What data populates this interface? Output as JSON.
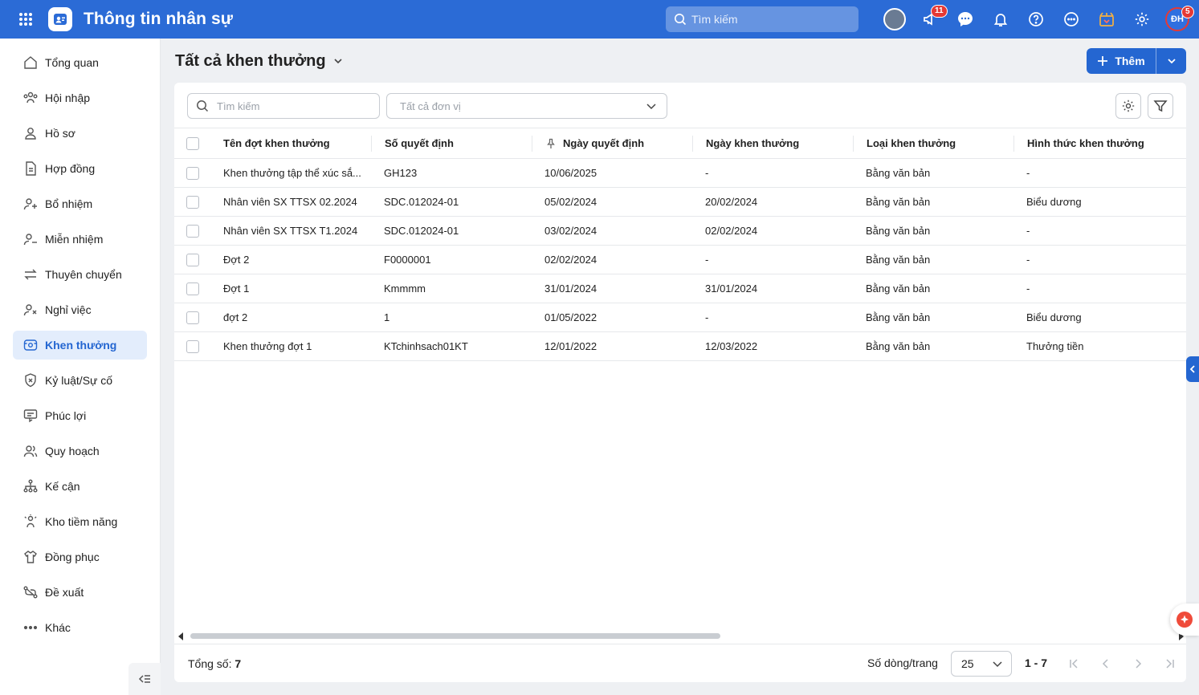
{
  "app": {
    "title": "Thông tin nhân sự",
    "search_placeholder": "Tìm kiếm",
    "user_initials": "ĐH"
  },
  "badges": {
    "announcements": "11",
    "avatar": "5"
  },
  "sidebar": {
    "items": [
      {
        "label": "Tổng quan",
        "icon": "home-icon"
      },
      {
        "label": "Hội nhập",
        "icon": "people-join-icon"
      },
      {
        "label": "Hồ sơ",
        "icon": "user-icon"
      },
      {
        "label": "Hợp đồng",
        "icon": "document-icon"
      },
      {
        "label": "Bổ nhiệm",
        "icon": "user-plus-icon"
      },
      {
        "label": "Miễn nhiệm",
        "icon": "user-minus-icon"
      },
      {
        "label": "Thuyên chuyển",
        "icon": "transfer-icon"
      },
      {
        "label": "Nghỉ việc",
        "icon": "user-x-icon"
      },
      {
        "label": "Khen thưởng",
        "icon": "reward-icon",
        "active": true
      },
      {
        "label": "Kỷ luật/Sự cố",
        "icon": "shield-x-icon"
      },
      {
        "label": "Phúc lợi",
        "icon": "benefit-icon"
      },
      {
        "label": "Quy hoạch",
        "icon": "users-icon"
      },
      {
        "label": "Kế cận",
        "icon": "hierarchy-icon"
      },
      {
        "label": "Kho tiềm năng",
        "icon": "talent-icon"
      },
      {
        "label": "Đồng phục",
        "icon": "shirt-icon"
      },
      {
        "label": "Đề xuất",
        "icon": "route-icon"
      },
      {
        "label": "Khác",
        "icon": "more-icon"
      }
    ]
  },
  "page": {
    "title": "Tất cả khen thưởng",
    "add_label": "Thêm"
  },
  "filters": {
    "search_placeholder": "Tìm kiếm",
    "unit_placeholder": "Tất cả đơn vị"
  },
  "table": {
    "columns": [
      "Tên đợt khen thưởng",
      "Số quyết định",
      "Ngày quyết định",
      "Ngày khen thưởng",
      "Loại khen thưởng",
      "Hình thức khen thưởng"
    ],
    "rows": [
      [
        "Khen thưởng tập thể xúc sắ...",
        "GH123",
        "10/06/2025",
        "-",
        "Bằng văn bản",
        "-"
      ],
      [
        "Nhân viên SX TTSX 02.2024",
        "SDC.012024-01",
        "05/02/2024",
        "20/02/2024",
        "Bằng văn bản",
        "Biểu dương"
      ],
      [
        "Nhân viên SX TTSX T1.2024",
        "SDC.012024-01",
        "03/02/2024",
        "02/02/2024",
        "Bằng văn bản",
        "-"
      ],
      [
        "Đợt 2",
        "F0000001",
        "02/02/2024",
        "-",
        "Bằng văn bản",
        "-"
      ],
      [
        "Đợt 1",
        "Kmmmm",
        "31/01/2024",
        "31/01/2024",
        "Bằng văn bản",
        "-"
      ],
      [
        "đợt 2",
        "1",
        "01/05/2022",
        "-",
        "Bằng văn bản",
        "Biểu dương"
      ],
      [
        "Khen thưởng đợt 1",
        "KTchinhsach01KT",
        "12/01/2022",
        "12/03/2022",
        "Bằng văn bản",
        "Thưởng tiền"
      ]
    ]
  },
  "footer": {
    "total_label": "Tổng số:",
    "total": "7",
    "rows_label": "Số dòng/trang",
    "page_size": "25",
    "range": "1 - 7"
  },
  "colors": {
    "primary": "#2466d1",
    "topbar": "#2b6bd6",
    "badge": "#e53935"
  }
}
